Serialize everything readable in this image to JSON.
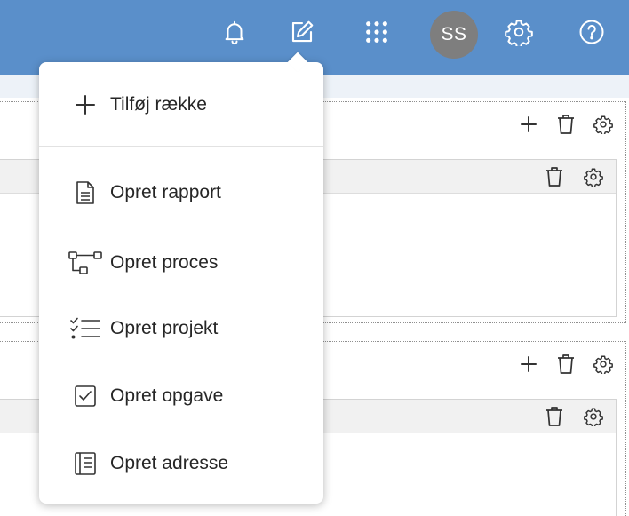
{
  "colors": {
    "topbar": "#5a8fca",
    "avatar_bg": "#7e7e7e",
    "menu_text": "#262626",
    "icon_dark": "#333333"
  },
  "topbar": {
    "icons": [
      "bell-icon",
      "edit-icon",
      "apps-grid-icon",
      "settings-gear-icon",
      "help-icon"
    ],
    "avatar_initials": "SS"
  },
  "menu": {
    "add_row": {
      "label": "Tilføj række",
      "icon": "plus-icon"
    },
    "items": [
      {
        "label": "Opret rapport",
        "icon": "document-icon"
      },
      {
        "label": "Opret proces",
        "icon": "process-flow-icon"
      },
      {
        "label": "Opret projekt",
        "icon": "checklist-icon"
      },
      {
        "label": "Opret opgave",
        "icon": "checkbox-icon"
      },
      {
        "label": "Opret adresse",
        "icon": "address-book-icon"
      }
    ]
  },
  "panels": {
    "tool_icons": [
      "plus-icon",
      "trash-icon",
      "gear-icon"
    ]
  }
}
